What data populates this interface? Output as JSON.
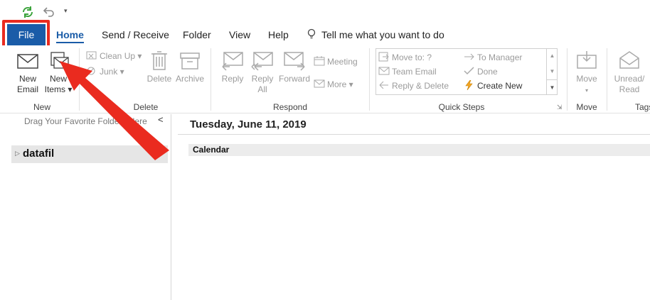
{
  "tabs": {
    "file": "File",
    "home": "Home",
    "send_receive": "Send / Receive",
    "folder": "Folder",
    "view": "View",
    "help": "Help",
    "tell_me": "Tell me what you want to do"
  },
  "ribbon": {
    "new_email": [
      "New",
      "Email"
    ],
    "new_items": [
      "New",
      "Items ▾"
    ],
    "clean_up": "Clean Up ▾",
    "junk": "Junk ▾",
    "delete": "Delete",
    "archive": "Archive",
    "reply": "Reply",
    "reply_all": [
      "Reply",
      "All"
    ],
    "forward": "Forward",
    "meeting": "Meeting",
    "more": "More ▾",
    "qs_move_to": "Move to: ?",
    "qs_team_email": "Team Email",
    "qs_reply_delete": "Reply & Delete",
    "qs_to_manager": "To Manager",
    "qs_done": "Done",
    "qs_create_new": "Create New",
    "move": "Move",
    "unread_read": [
      "Unread/",
      "Read"
    ],
    "groups": {
      "new": "New",
      "delete": "Delete",
      "respond": "Respond",
      "quick_steps": "Quick Steps",
      "move": "Move",
      "tags": "Tags"
    }
  },
  "nav": {
    "hint": "Drag Your Favorite Folders Here",
    "collapse": "<",
    "folder": "datafil"
  },
  "main": {
    "date": "Tuesday, June 11, 2019",
    "calendar": "Calendar"
  },
  "colors": {
    "file_tab": "#1a5ca8",
    "highlight": "#ea2b1f"
  }
}
